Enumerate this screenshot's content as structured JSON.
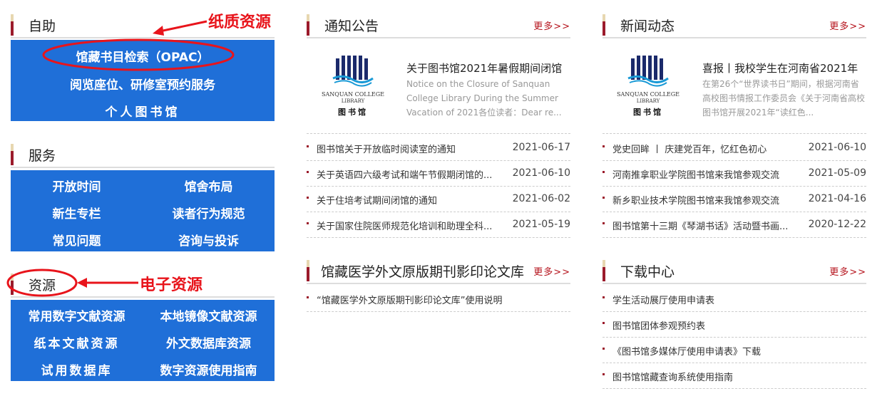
{
  "sections": {
    "self_service": {
      "title": "自助",
      "items": [
        "馆藏书目检索（OPAC）",
        "阅览座位、研修室预约服务",
        "个人图书馆"
      ]
    },
    "service": {
      "title": "服务",
      "items": [
        "开放时间",
        "馆舍布局",
        "新生专栏",
        "读者行为规范",
        "常见问题",
        "咨询与投诉"
      ]
    },
    "resources": {
      "title": "资源",
      "items": [
        "常用数字文献资源",
        "本地镜像文献资源",
        "纸本文献资源",
        "外文数据库资源",
        "试用数据库",
        "数字资源使用指南"
      ]
    }
  },
  "annotations": {
    "paper": "纸质资源",
    "electronic": "电子资源"
  },
  "notice": {
    "title": "通知公告",
    "more": "更多>>",
    "featured": {
      "title": "关于图书馆2021年暑假期间闭馆",
      "desc": "Notice on the Closure of Sanquan College Library During the Summer Vacation of 2021各位读者：Dear re..."
    },
    "items": [
      {
        "text": "图书馆关于开放临时阅读室的通知",
        "date": "2021-06-17"
      },
      {
        "text": "关于英语四六级考试和端午节假期闭馆的...",
        "date": "2021-06-10"
      },
      {
        "text": "关于住培考试期间闭馆的通知",
        "date": "2021-06-02"
      },
      {
        "text": "关于国家住院医师规范化培训和助理全科...",
        "date": "2021-05-19"
      }
    ]
  },
  "news": {
    "title": "新闻动态",
    "more": "更多>>",
    "featured": {
      "title": "喜报丨我校学生在河南省2021年",
      "desc": "在第26个“世界读书日”期间，根据河南省高校图书情报工作委员会《关于河南省高校图书馆开展2021年“读红色..."
    },
    "items": [
      {
        "text": "党史回眸 丨 庆建党百年，忆红色初心",
        "date": "2021-06-10"
      },
      {
        "text": "河南推拿职业学院图书馆来我馆参观交流",
        "date": "2021-05-09"
      },
      {
        "text": "新乡职业技术学院图书馆来我馆参观交流",
        "date": "2021-04-16"
      },
      {
        "text": "图书馆第十三期《琴湖书话》活动暨书画...",
        "date": "2020-12-22"
      }
    ]
  },
  "foreign": {
    "title": "馆藏医学外文原版期刊影印论文库",
    "more": "更多>>",
    "items": [
      {
        "text": "“馆藏医学外文原版期刊影印论文库”使用说明"
      }
    ]
  },
  "download": {
    "title": "下载中心",
    "more": "更多>>",
    "items": [
      {
        "text": "学生活动展厅使用申请表"
      },
      {
        "text": "图书馆团体参观预约表"
      },
      {
        "text": "《图书馆多媒体厅使用申请表》下载"
      },
      {
        "text": "图书馆馆藏查询系统使用指南"
      }
    ]
  },
  "logo": {
    "line1": "SANQUAN COLLEGE",
    "line2": "LIBRARY",
    "line3": "图书馆"
  },
  "colors": {
    "blue": "#1f6fd8",
    "accent": "#9b1b2b",
    "annotation_red": "#e8141b"
  }
}
